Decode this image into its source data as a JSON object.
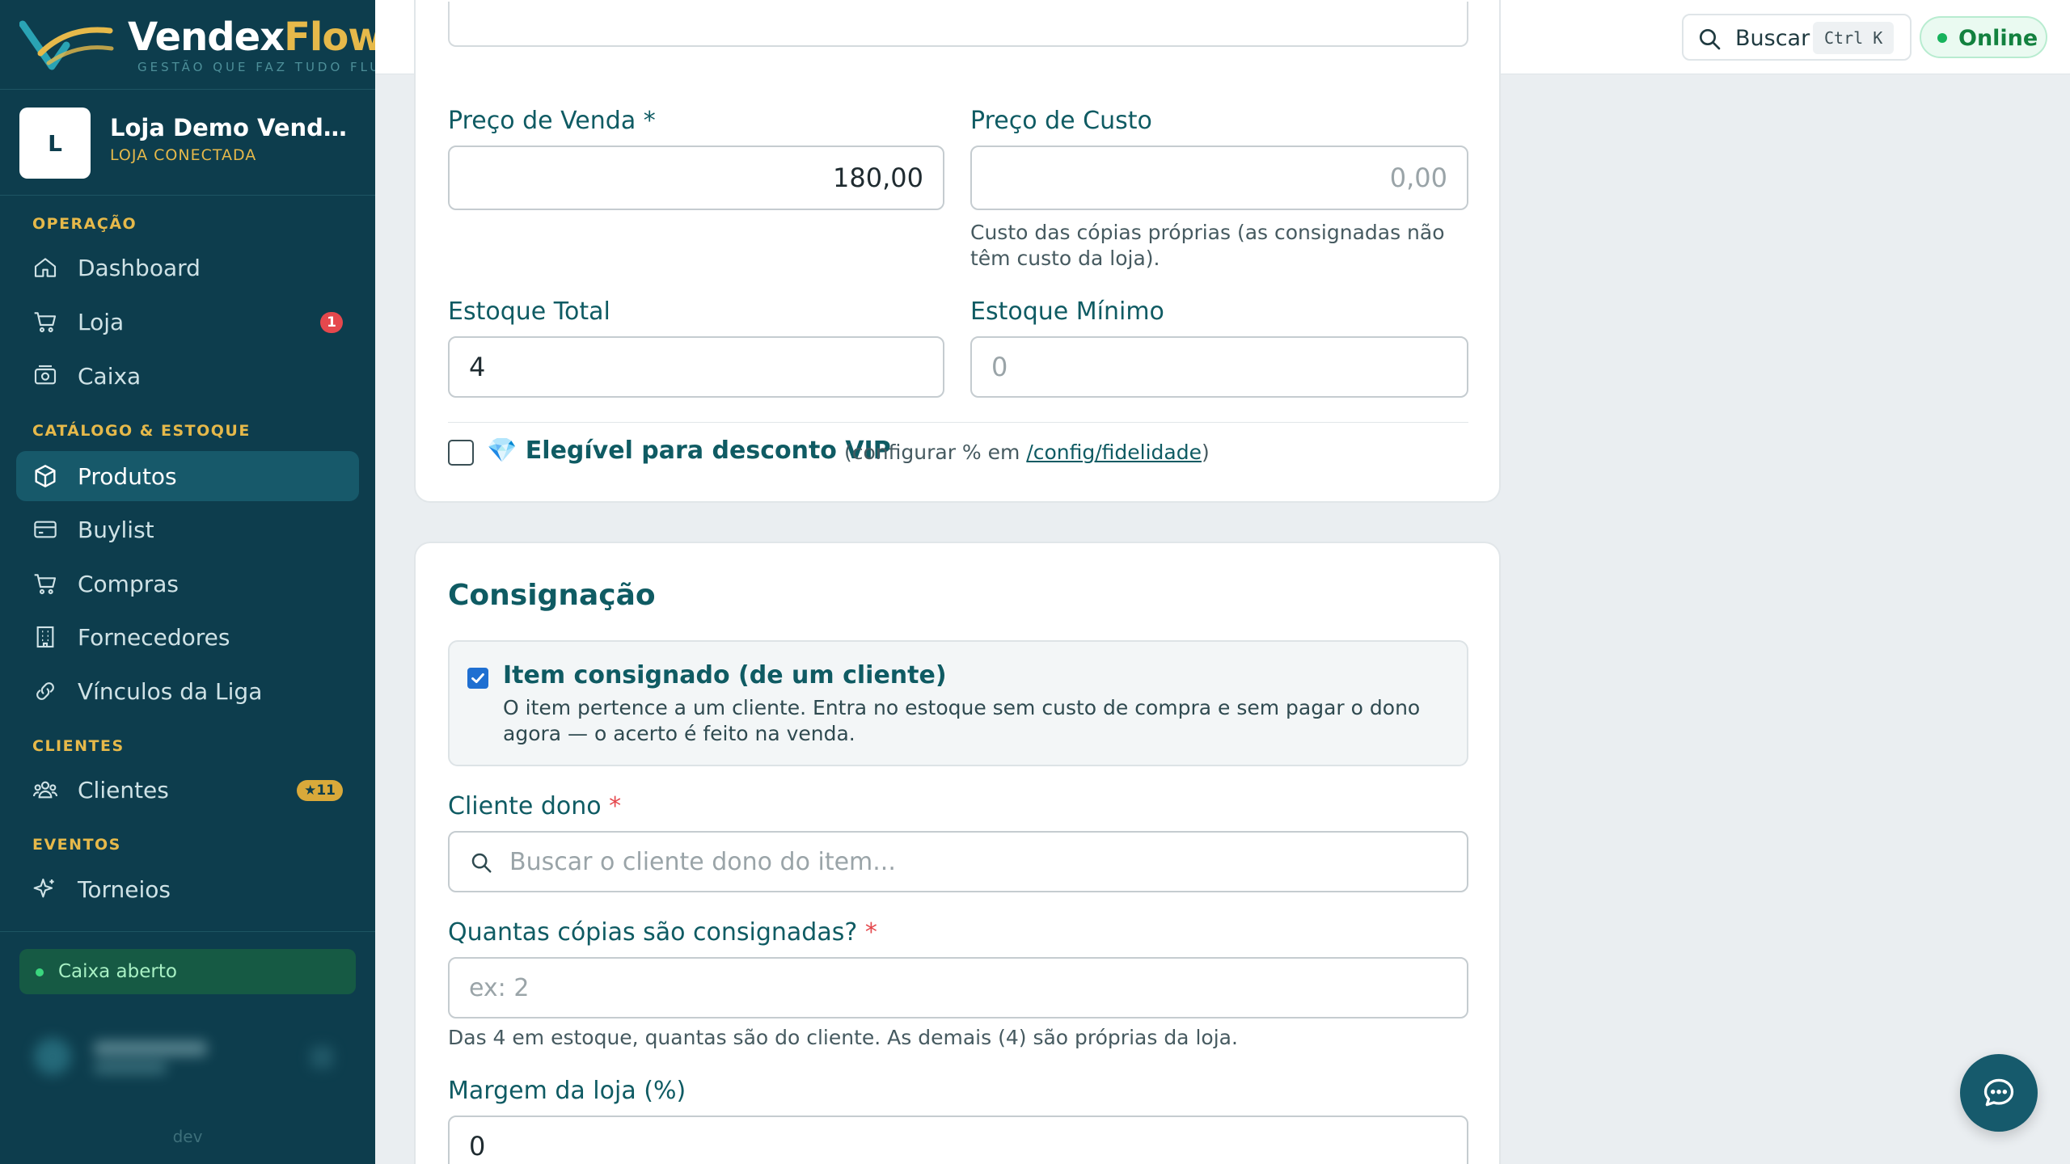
{
  "brand": {
    "name_main": "Vendex",
    "name_accent": "Flow",
    "tagline": "GESTÃO QUE FAZ TUDO FLUIR",
    "accent_color": "#e6b94a",
    "sidebar_color": "#0d3d4d"
  },
  "store": {
    "avatar_letter": "L",
    "name": "Loja Demo VendexFlow",
    "status": "LOJA CONECTADA"
  },
  "sidebar": {
    "sections": [
      {
        "label": "OPERAÇÃO"
      },
      {
        "label": "CATÁLOGO & ESTOQUE"
      },
      {
        "label": "CLIENTES"
      },
      {
        "label": "EVENTOS"
      }
    ],
    "items": [
      {
        "label": "Dashboard",
        "icon": "home-icon"
      },
      {
        "label": "Loja",
        "icon": "cart-icon",
        "badge": "1"
      },
      {
        "label": "Caixa",
        "icon": "cash-register-icon"
      },
      {
        "label": "Produtos",
        "icon": "box-icon",
        "active": true
      },
      {
        "label": "Buylist",
        "icon": "card-icon"
      },
      {
        "label": "Compras",
        "icon": "cart-icon"
      },
      {
        "label": "Fornecedores",
        "icon": "building-icon"
      },
      {
        "label": "Vínculos da Liga",
        "icon": "link-icon"
      },
      {
        "label": "Clientes",
        "icon": "users-icon",
        "badge": "★11"
      },
      {
        "label": "Torneios",
        "icon": "sparkle-icon"
      }
    ],
    "cash_status": "Caixa aberto",
    "env_label": "dev"
  },
  "topbar": {
    "search_label": "Buscar",
    "search_shortcut": "Ctrl K",
    "status_label": "Online",
    "status_color": "#17b35c"
  },
  "pricing": {
    "sale_price_label": "Preço de Venda",
    "sale_price_required": "*",
    "sale_price_value": "180,00",
    "cost_price_label": "Preço de Custo",
    "cost_price_placeholder": "0,00",
    "cost_price_help": "Custo das cópias próprias (as consignadas não têm custo da loja).",
    "stock_total_label": "Estoque Total",
    "stock_total_value": "4",
    "stock_min_label": "Estoque Mínimo",
    "stock_min_placeholder": "0",
    "vip_label": "💎 Elegível para desconto VIP",
    "vip_checked": false,
    "vip_note_prefix": "(configurar % em ",
    "vip_link": "/config/fidelidade",
    "vip_note_suffix": ")"
  },
  "consignment": {
    "title": "Consignação",
    "item_label": "Item consignado (de um cliente)",
    "item_checked": true,
    "item_description": "O item pertence a um cliente. Entra no estoque sem custo de compra e sem pagar o dono agora — o acerto é feito na venda.",
    "owner_label": "Cliente dono",
    "owner_required": "*",
    "owner_placeholder": "Buscar o cliente dono do item...",
    "copies_label": "Quantas cópias são consignadas?",
    "copies_required": "*",
    "copies_placeholder": "ex: 2",
    "copies_help": "Das 4 em estoque, quantas são do cliente. As demais (4) são próprias da loja.",
    "margin_label": "Margem da loja (%)",
    "margin_value": "0"
  }
}
